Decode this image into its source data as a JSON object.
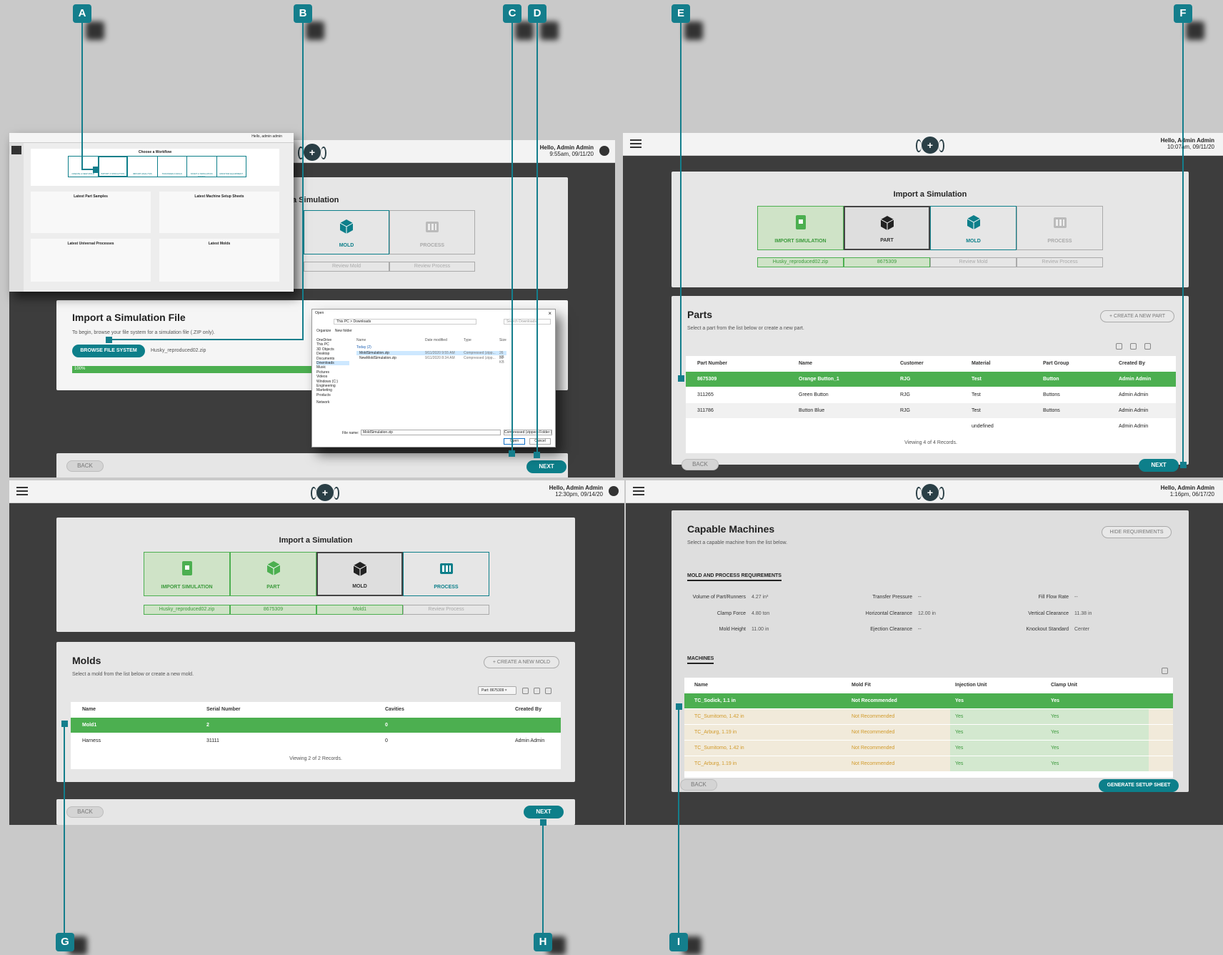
{
  "callouts": [
    "A",
    "B",
    "C",
    "D",
    "E",
    "F",
    "G",
    "H",
    "I"
  ],
  "common": {
    "back": "BACK",
    "next": "NEXT",
    "import_title": "Import a Simulation",
    "steps": [
      "IMPORT SIMULATION",
      "PART",
      "MOLD",
      "PROCESS"
    ]
  },
  "panel1": {
    "greeting": "Hello, Admin Admin",
    "time": "9:55am, 09/11/20",
    "title_partial": "a Simulation",
    "step_mold": "MOLD",
    "step_process": "PROCESS",
    "review_mold": "Review Mold",
    "review_process": "Review Process",
    "file_card": {
      "title": "Import a Simulation File",
      "desc": "To begin, browse your file system for a simulation file (.ZIP only).",
      "browse": "BROWSE FILE SYSTEM",
      "filename": "Husky_reproduced02.zip",
      "progress": "100%",
      "progress_value": 1.0
    },
    "dashboard": {
      "choose": "Choose a Workflow",
      "workflows": [
        "CREATE A NEW MOLD",
        "IMPORT A SIMULATION",
        "IMPORT ANALYSIS",
        "TRANSFER A MOLD",
        "START A SIMULATION STUDY",
        "MONITOR EQUIPMENT"
      ],
      "sec_part_samples": "Latest Part Samples",
      "sec_setup_sheets": "Latest Machine Setup Sheets",
      "sec_processes": "Latest Universal Processes",
      "sec_molds": "Latest Molds",
      "greeting": "Hello, admin admin"
    },
    "dialog": {
      "title": "Open",
      "path": "This PC > Downloads",
      "search": "Search Downloads",
      "organize": "Organize",
      "new_folder": "New folder",
      "columns": [
        "Name",
        "Date modified",
        "Type",
        "Size"
      ],
      "group": "Today (2)",
      "files": [
        {
          "name": "MoldSimulation.zip",
          "date": "9/11/2020 9:55 AM",
          "type": "Compressed (zipp...",
          "size": "26 KB"
        },
        {
          "name": "NewMoldSimulation.zip",
          "date": "9/11/2020 8:34 AM",
          "type": "Compressed (zipp...",
          "size": "20 KB"
        }
      ],
      "tree": [
        "OneDrive",
        "This PC",
        "3D Objects",
        "Desktop",
        "Documents",
        "Downloads",
        "Music",
        "Pictures",
        "Videos",
        "Windows (C:)",
        "Engineering",
        "Marketing",
        "Products",
        "Network"
      ],
      "file_name_label": "File name:",
      "file_name": "MoldSimulation.zip",
      "file_type": "Compressed (zipped) Folder (*.",
      "open": "Open",
      "cancel": "Cancel"
    }
  },
  "panel2": {
    "greeting": "Hello, Admin Admin",
    "time": "10:07am, 09/11/20",
    "status": [
      "Husky_reproduced02.zip",
      "8675309",
      "Review Mold",
      "Review Process"
    ],
    "parts_title": "Parts",
    "parts_desc": "Select a part from the list below or create a new part.",
    "create": "+ CREATE A NEW PART",
    "columns": [
      "Part Number",
      "Name",
      "Customer",
      "Material",
      "Part Group",
      "Created By"
    ],
    "rows": [
      [
        "8675309",
        "Orange Button_1",
        "RJG",
        "Test",
        "Button",
        "Admin Admin"
      ],
      [
        "311265",
        "Green Button",
        "RJG",
        "Test",
        "Buttons",
        "Admin Admin"
      ],
      [
        "311786",
        "Button Blue",
        "RJG",
        "Test",
        "Buttons",
        "Admin Admin"
      ],
      [
        "",
        "",
        "",
        "undefined",
        "",
        "Admin Admin"
      ]
    ],
    "footer": "Viewing 4 of 4 Records."
  },
  "panel3": {
    "greeting": "Hello, Admin Admin",
    "time": "12:30pm, 09/14/20",
    "status": [
      "Husky_reproduced02.zip",
      "8675309",
      "Mold1",
      "Review Process"
    ],
    "molds_title": "Molds",
    "molds_desc": "Select a mold from the list below or create a new mold.",
    "create": "+ CREATE A NEW MOLD",
    "filter": "Part: 8675309",
    "columns": [
      "Name",
      "Serial Number",
      "Cavities",
      "Created By"
    ],
    "rows": [
      [
        "Mold1",
        "2",
        "0",
        ""
      ],
      [
        "Harness",
        "31111",
        "0",
        "Admin Admin"
      ]
    ],
    "footer": "Viewing 2 of 2 Records."
  },
  "panel4": {
    "greeting": "Hello, Admin Admin",
    "time": "1:16pm, 06/17/20",
    "title": "Capable Machines",
    "desc": "Select a capable machine from the list below.",
    "hide": "HIDE REQUIREMENTS",
    "req_heading": "MOLD AND PROCESS REQUIREMENTS",
    "reqs": [
      {
        "k": "Volume of Part/Runners",
        "v": "4.27 in³"
      },
      {
        "k": "Clamp Force",
        "v": "4.80 ton"
      },
      {
        "k": "Mold Height",
        "v": "11.00 in"
      },
      {
        "k": "Transfer Pressure",
        "v": "--"
      },
      {
        "k": "Horizontal Clearance",
        "v": "12.00 in"
      },
      {
        "k": "Ejection Clearance",
        "v": "--"
      },
      {
        "k": "Fill Flow Rate",
        "v": "--"
      },
      {
        "k": "Vertical Clearance",
        "v": "11.38 in"
      },
      {
        "k": "Knockout Standard",
        "v": "Center"
      }
    ],
    "machines_heading": "MACHINES",
    "columns": [
      "Name",
      "Mold Fit",
      "Injection Unit",
      "Clamp Unit"
    ],
    "rows": [
      [
        "TC_Sodick, 1.1 in",
        "Not Recommended",
        "Yes",
        "Yes"
      ],
      [
        "TC_Sumitomo, 1.42 in",
        "Not Recommended",
        "Yes",
        "Yes"
      ],
      [
        "TC_Arburg, 1.19 in",
        "Not Recommended",
        "Yes",
        "Yes"
      ],
      [
        "TC_Sumitomo, 1.42 in",
        "Not Recommended",
        "Yes",
        "Yes"
      ],
      [
        "TC_Arburg, 1.19 in",
        "Not Recommended",
        "Yes",
        "Yes"
      ]
    ],
    "generate": "GENERATE SETUP SHEET"
  },
  "colors": {
    "teal": "#0d7f8a",
    "callout": "#147e8c",
    "green": "#4caf50",
    "warn": "#d19a2a"
  }
}
